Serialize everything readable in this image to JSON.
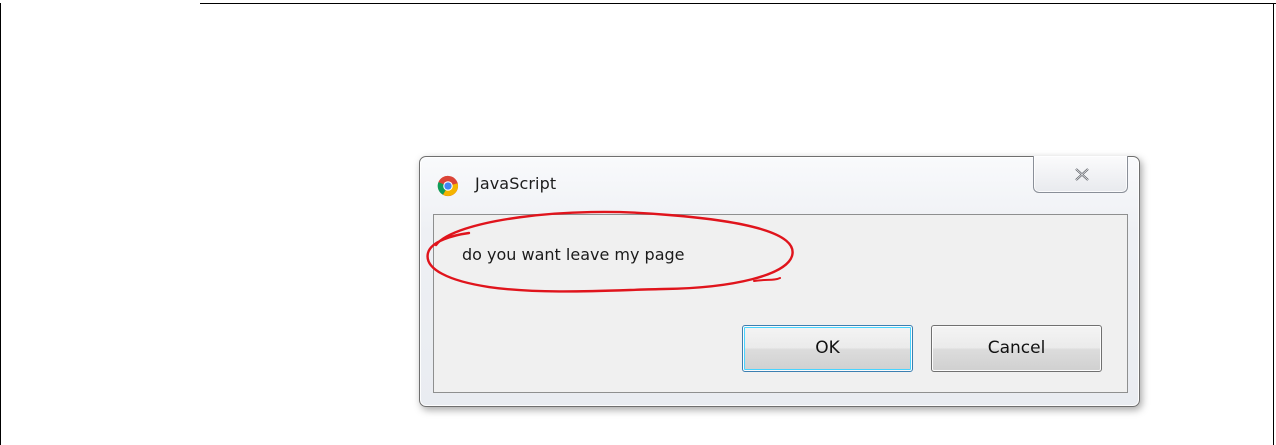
{
  "dialog": {
    "title": "JavaScript",
    "message": "do you want leave my page",
    "ok_label": "OK",
    "cancel_label": "Cancel",
    "close_glyph": "close-icon",
    "app_icon": "chrome-icon"
  },
  "colors": {
    "annotation": "#e0141c",
    "ok_focus": "#48d4ff",
    "dialog_background": "#f0f0f0"
  }
}
